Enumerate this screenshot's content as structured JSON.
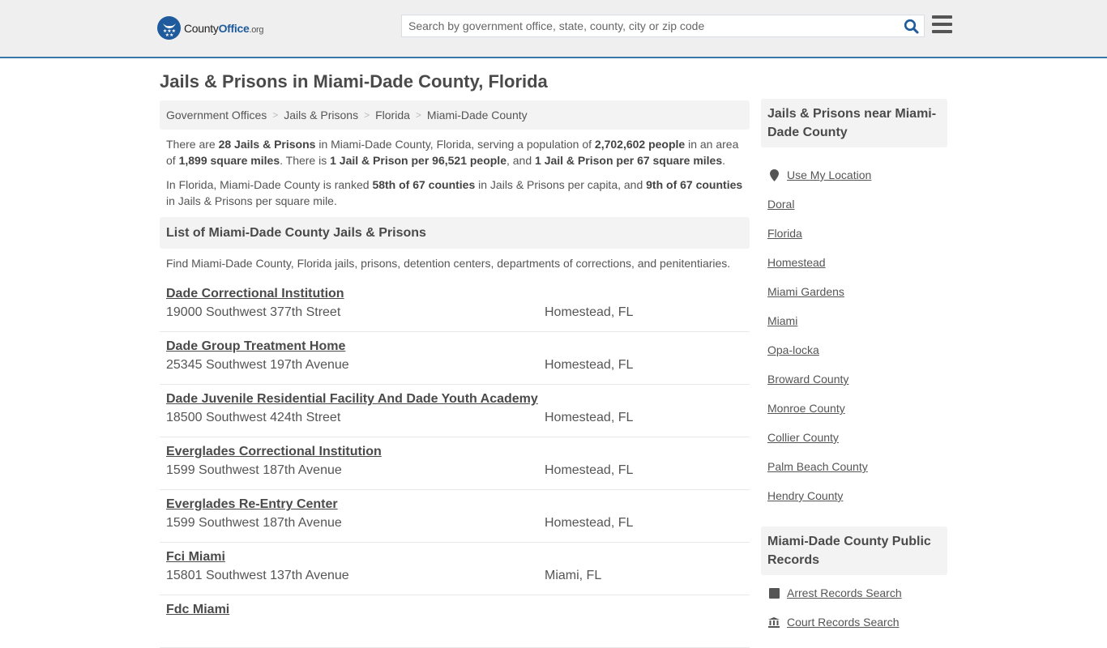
{
  "header": {
    "logo": {
      "name": "County",
      "name_bold": "Office",
      "tld": ".org"
    },
    "search": {
      "placeholder": "Search by government office, state, county, city or zip code",
      "value": ""
    }
  },
  "page_title": "Jails & Prisons in Miami-Dade County, Florida",
  "breadcrumb": [
    "Government Offices",
    "Jails & Prisons",
    "Florida",
    "Miami-Dade County"
  ],
  "intro": {
    "p1": {
      "t1": "There are ",
      "b1": "28 Jails & Prisons",
      "t2": " in Miami-Dade County, Florida, serving a population of ",
      "b2": "2,702,602 people",
      "t3": " in an area of ",
      "b3": "1,899 square miles",
      "t4": ". There is ",
      "b4": "1 Jail & Prison per 96,521 people",
      "t5": ", and ",
      "b5": "1 Jail & Prison per 67 square miles",
      "t6": "."
    },
    "p2": {
      "t1": "In Florida, Miami-Dade County is ranked ",
      "b1": "58th of 67 counties",
      "t2": " in Jails & Prisons per capita, and ",
      "b2": "9th of 67 counties",
      "t3": " in Jails & Prisons per square mile."
    }
  },
  "list_section": {
    "title": "List of Miami-Dade County Jails & Prisons",
    "description": "Find Miami-Dade County, Florida jails, prisons, detention centers, departments of corrections, and penitentiaries.",
    "items": [
      {
        "name": "Dade Correctional Institution",
        "address": "19000 Southwest 377th Street",
        "city": "Homestead, FL"
      },
      {
        "name": "Dade Group Treatment Home",
        "address": "25345 Southwest 197th Avenue",
        "city": "Homestead, FL"
      },
      {
        "name": "Dade Juvenile Residential Facility And Dade Youth Academy",
        "address": "18500 Southwest 424th Street",
        "city": "Homestead, FL"
      },
      {
        "name": "Everglades Correctional Institution",
        "address": "1599 Southwest 187th Avenue",
        "city": "Homestead, FL"
      },
      {
        "name": "Everglades Re-Entry Center",
        "address": "1599 Southwest 187th Avenue",
        "city": "Homestead, FL"
      },
      {
        "name": "Fci Miami",
        "address": "15801 Southwest 137th Avenue",
        "city": "Miami, FL"
      },
      {
        "name": "Fdc Miami",
        "address": "",
        "city": ""
      }
    ]
  },
  "sidebar": {
    "nearby_title": "Jails & Prisons near Miami-Dade County",
    "use_location": {
      "label": "Use My Location",
      "icon": "map-marker-icon"
    },
    "nearby": [
      "Doral",
      "Florida",
      "Homestead",
      "Miami Gardens",
      "Miami",
      "Opa-locka",
      "Broward County",
      "Monroe County",
      "Collier County",
      "Palm Beach County",
      "Hendry County"
    ],
    "records_title": "Miami-Dade County Public Records",
    "records": [
      {
        "label": "Arrest Records Search",
        "icon": "square-icon"
      },
      {
        "label": "Court Records Search",
        "icon": "courthouse-icon"
      }
    ]
  }
}
